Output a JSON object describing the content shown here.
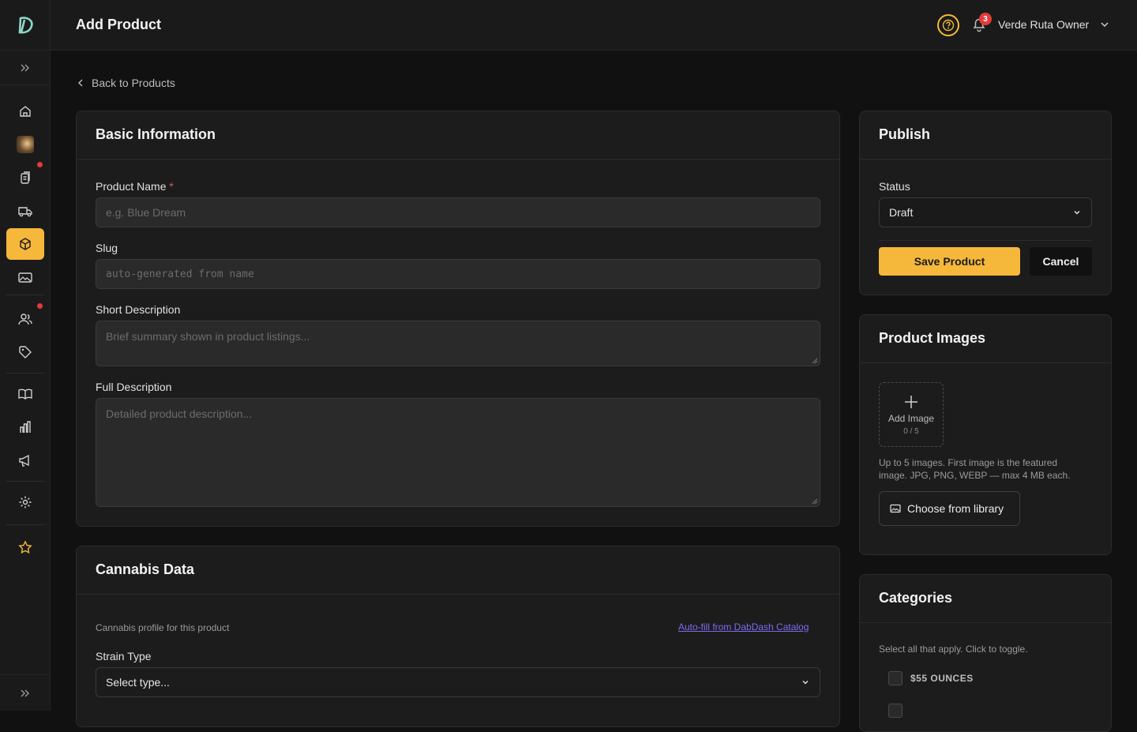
{
  "header": {
    "title": "Add Product",
    "notification_count": "3",
    "user_name": "Verde Ruta Owner"
  },
  "back_link": "Back to Products",
  "basic_info": {
    "title": "Basic Information",
    "product_name_label": "Product Name",
    "required_mark": "*",
    "product_name_placeholder": "e.g. Blue Dream",
    "slug_label": "Slug",
    "slug_placeholder": "auto-generated from name",
    "short_desc_label": "Short Description",
    "short_desc_placeholder": "Brief summary shown in product listings...",
    "full_desc_label": "Full Description",
    "full_desc_placeholder": "Detailed product description..."
  },
  "cannabis": {
    "title": "Cannabis Data",
    "subtitle": "Cannabis profile for this product",
    "autofill_link": "Auto-fill from DabDash Catalog",
    "strain_label": "Strain Type",
    "strain_value": "Select type..."
  },
  "publish": {
    "title": "Publish",
    "status_label": "Status",
    "status_value": "Draft",
    "save_label": "Save Product",
    "cancel_label": "Cancel"
  },
  "images": {
    "title": "Product Images",
    "add_label": "Add Image",
    "count": "0 / 5",
    "hint_line1": "Up to 5 images. First image is the featured",
    "hint_line2": "image. JPG, PNG, WEBP — max 4 MB each.",
    "library_label": "Choose from library"
  },
  "categories": {
    "title": "Categories",
    "hint": "Select all that apply. Click to toggle.",
    "items": [
      "$55 OUNCES"
    ]
  },
  "colors": {
    "accent": "#f5b83a",
    "badge": "#e23b3b",
    "link": "#7c6cf0"
  },
  "sidebar_icons": [
    "home-icon",
    "store-avatar",
    "orders-icon",
    "delivery-icon",
    "products-icon",
    "media-icon",
    "customers-icon",
    "tags-icon",
    "catalog-icon",
    "analytics-icon",
    "marketing-icon",
    "settings-icon",
    "star-icon"
  ]
}
